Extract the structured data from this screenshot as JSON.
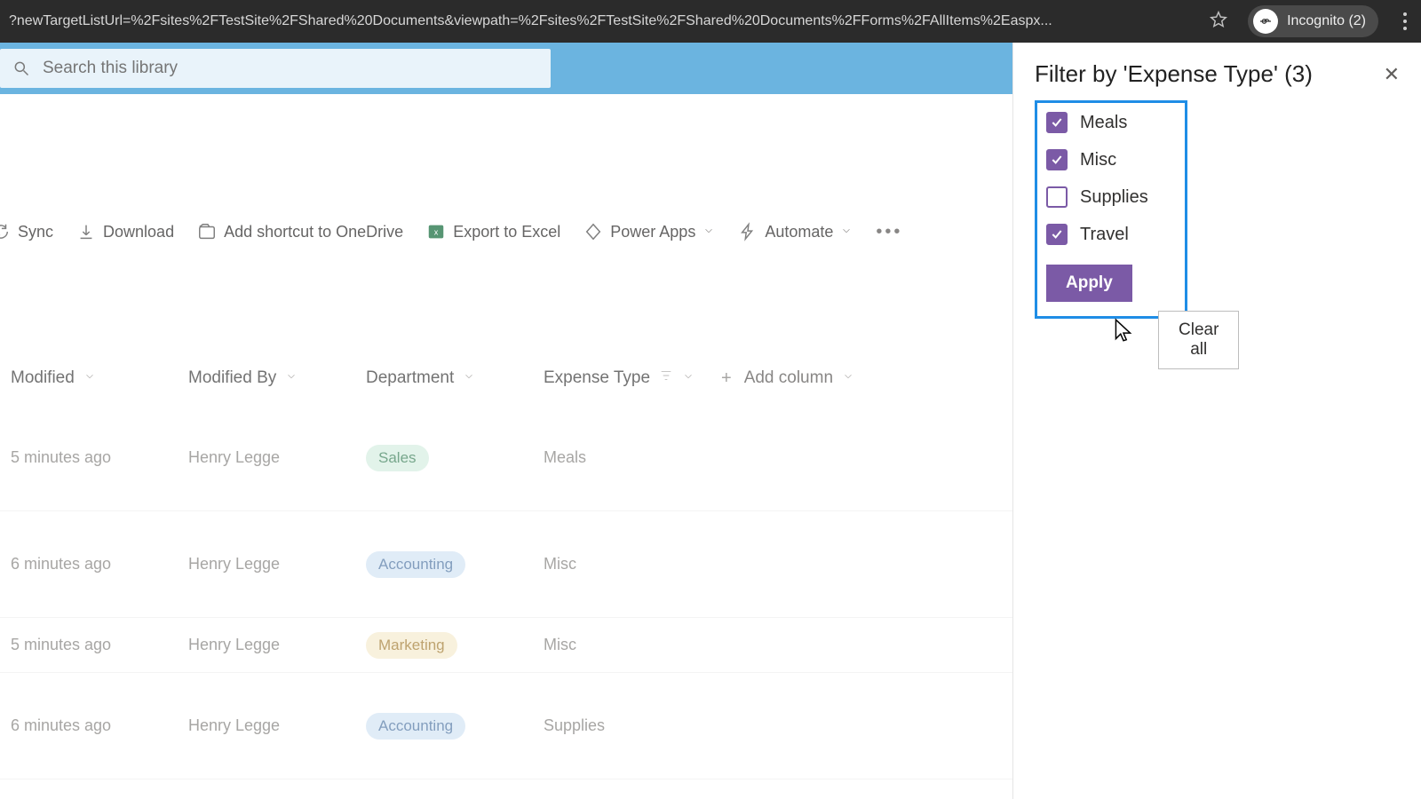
{
  "browser": {
    "url_fragment": "?newTargetListUrl=%2Fsites%2FTestSite%2FShared%20Documents&viewpath=%2Fsites%2FTestSite%2FShared%20Documents%2FForms%2FAllItems%2Easpx...",
    "incognito_label": "Incognito (2)"
  },
  "search": {
    "placeholder": "Search this library"
  },
  "commands": {
    "sync": "Sync",
    "download": "Download",
    "shortcut": "Add shortcut to OneDrive",
    "export": "Export to Excel",
    "powerapps": "Power Apps",
    "automate": "Automate"
  },
  "columns": {
    "modified": "Modified",
    "modified_by": "Modified By",
    "department": "Department",
    "expense_type": "Expense Type",
    "add_column": "Add column"
  },
  "rows": [
    {
      "modified": "5 minutes ago",
      "by": "Henry Legge",
      "dept": "Sales",
      "dept_class": "pill-sales",
      "expense": "Meals",
      "tall": true
    },
    {
      "modified": "6 minutes ago",
      "by": "Henry Legge",
      "dept": "Accounting",
      "dept_class": "pill-accounting",
      "expense": "Misc",
      "tall": true
    },
    {
      "modified": "5 minutes ago",
      "by": "Henry Legge",
      "dept": "Marketing",
      "dept_class": "pill-marketing",
      "expense": "Misc",
      "tall": false
    },
    {
      "modified": "6 minutes ago",
      "by": "Henry Legge",
      "dept": "Accounting",
      "dept_class": "pill-accounting",
      "expense": "Supplies",
      "tall": true
    }
  ],
  "filter": {
    "title": "Filter by 'Expense Type' (3)",
    "options": [
      {
        "label": "Meals",
        "checked": true
      },
      {
        "label": "Misc",
        "checked": true
      },
      {
        "label": "Supplies",
        "checked": false
      },
      {
        "label": "Travel",
        "checked": true
      }
    ],
    "apply": "Apply",
    "clear": "Clear all"
  }
}
